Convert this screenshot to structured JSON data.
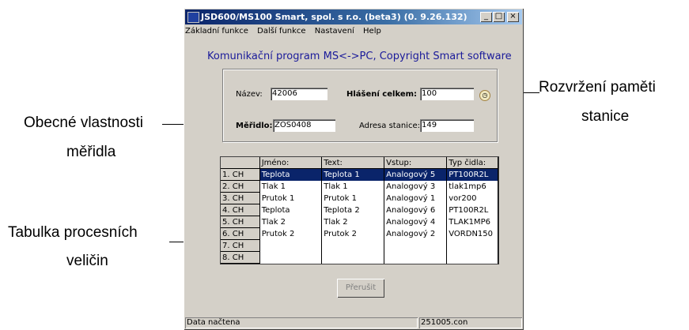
{
  "window": {
    "title": "JSD600/MS100 Smart, spol. s r.o. (beta3)  (0. 9.26.132)",
    "btn_min": "_",
    "btn_max": "□",
    "btn_close": "×"
  },
  "menu": [
    "Základní funkce",
    "Další funkce",
    "Nastavení",
    "Help"
  ],
  "heading": "Komunikační program MS<->PC, Copyright Smart software",
  "form": {
    "nazev_label": "Název:",
    "nazev_value": "42006",
    "hlaseni_label": "Hlášení celkem:",
    "hlaseni_value": "100",
    "meridlo_label": "Měřidlo:",
    "meridlo_value": "ZOS0408",
    "adresa_label": "Adresa stanice:",
    "adresa_value": "149"
  },
  "table": {
    "headers": [
      "",
      "Jméno:",
      "Text:",
      "Vstup:",
      "Typ čidla:"
    ],
    "rows": [
      [
        "1. CH",
        "Teplota",
        "Teplota 1",
        "Analogový 5",
        "PT100R2L"
      ],
      [
        "2. CH",
        "Tlak 1",
        "Tlak 1",
        "Analogový 3",
        "tlak1mp6"
      ],
      [
        "3. CH",
        "Prutok 1",
        "Prutok 1",
        "Analogový 1",
        "vor200"
      ],
      [
        "4. CH",
        "Teplota",
        "Teplota 2",
        "Analogový 6",
        "PT100R2L"
      ],
      [
        "5. CH",
        "Tlak 2",
        "Tlak 2",
        "Analogový 4",
        "TLAK1MP6"
      ],
      [
        "6. CH",
        "Prutok 2",
        "Prutok 2",
        "Analogový 2",
        "VORDN150"
      ],
      [
        "7. CH",
        "",
        "",
        "",
        ""
      ],
      [
        "8. CH",
        "",
        "",
        "",
        ""
      ]
    ]
  },
  "button_prerusit": "Přerušit",
  "status": {
    "left": "Data načtena",
    "right": "251005.con"
  },
  "annotations": {
    "rozvrzeni_1": "Rozvržení paměti",
    "rozvrzeni_2": "stanice",
    "obecne_1": "Obecné vlastnosti",
    "obecne_2": "měřidla",
    "tabulka_1": "Tabulka procesních",
    "tabulka_2": "veličin"
  }
}
